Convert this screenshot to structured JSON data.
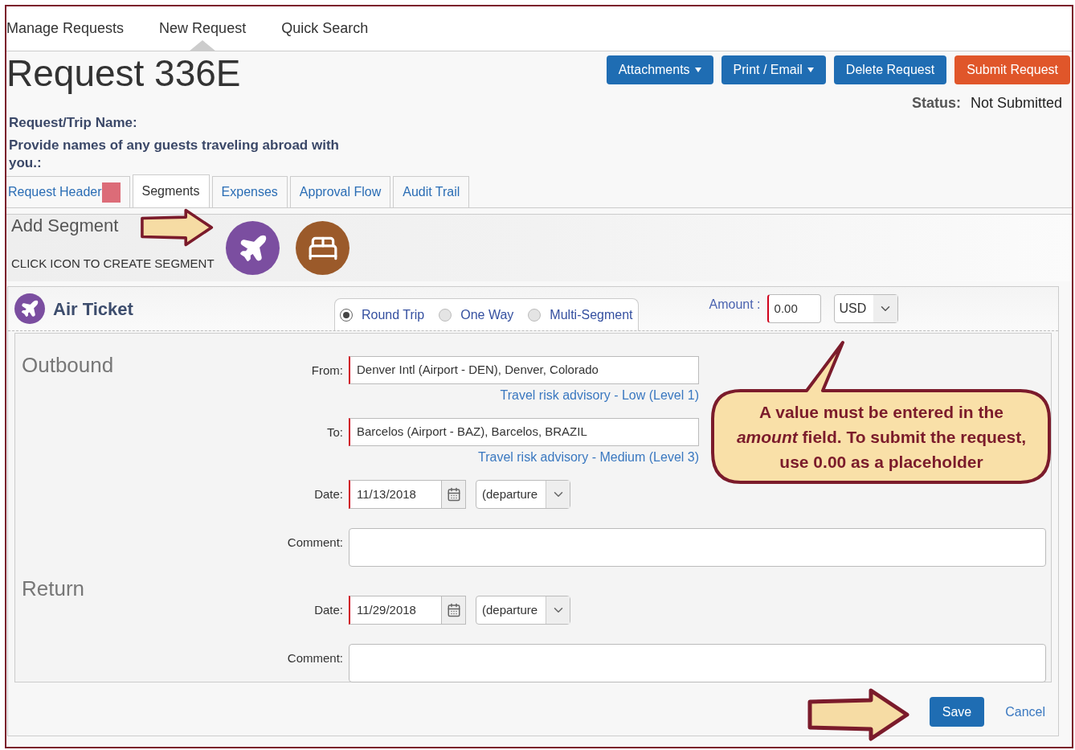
{
  "nav": [
    {
      "label": "Manage Requests",
      "selected": false
    },
    {
      "label": "New Request",
      "selected": true
    },
    {
      "label": "Quick Search",
      "selected": false
    }
  ],
  "title": "Request 336E",
  "buttons": [
    {
      "label": "Attachments",
      "kind": "menu"
    },
    {
      "label": "Print / Email",
      "kind": "menu"
    },
    {
      "label": "Delete Request",
      "kind": "action"
    },
    {
      "label": "Submit Request",
      "kind": "submit"
    }
  ],
  "status": {
    "label": "Status:",
    "value": "Not Submitted"
  },
  "header_fields": [
    "Request/Trip Name:",
    "Provide names of any guests traveling abroad with you.:"
  ],
  "tabs": [
    {
      "label": "Request Header",
      "selected": false,
      "flagged": true
    },
    {
      "label": "Segments",
      "selected": true,
      "flagged": false
    },
    {
      "label": "Expenses",
      "selected": false,
      "flagged": false
    },
    {
      "label": "Approval Flow",
      "selected": false,
      "flagged": false
    },
    {
      "label": "Audit Trail",
      "selected": false,
      "flagged": false
    }
  ],
  "add_segment": {
    "title": "Add Segment",
    "hint": "CLICK ICON TO CREATE SEGMENT"
  },
  "air_ticket": {
    "title": "Air Ticket",
    "trip_types": [
      {
        "label": "Round Trip",
        "selected": true
      },
      {
        "label": "One Way",
        "selected": false
      },
      {
        "label": "Multi-Segment",
        "selected": false
      }
    ],
    "amount": {
      "label": "Amount :",
      "value": "0.00"
    },
    "currency": "USD"
  },
  "outbound": {
    "title": "Outbound",
    "from": {
      "label": "From:",
      "value": "Denver Intl (Airport - DEN), Denver, Colorado",
      "advisory": "Travel risk advisory - Low (Level 1)"
    },
    "to": {
      "label": "To:",
      "value": "Barcelos (Airport - BAZ), Barcelos, BRAZIL",
      "advisory": "Travel risk advisory - Medium (Level 3)"
    },
    "date": {
      "label": "Date:",
      "value": "11/13/2018",
      "time": "(departure"
    },
    "comment": {
      "label": "Comment:"
    }
  },
  "return": {
    "title": "Return",
    "date": {
      "label": "Date:",
      "value": "11/29/2018",
      "time": "(departure"
    },
    "comment": {
      "label": "Comment:"
    }
  },
  "callout": "A value must be entered in the *amount* field. To submit the request, use 0.00 as a placeholder",
  "actions": {
    "save": "Save",
    "cancel": "Cancel"
  }
}
